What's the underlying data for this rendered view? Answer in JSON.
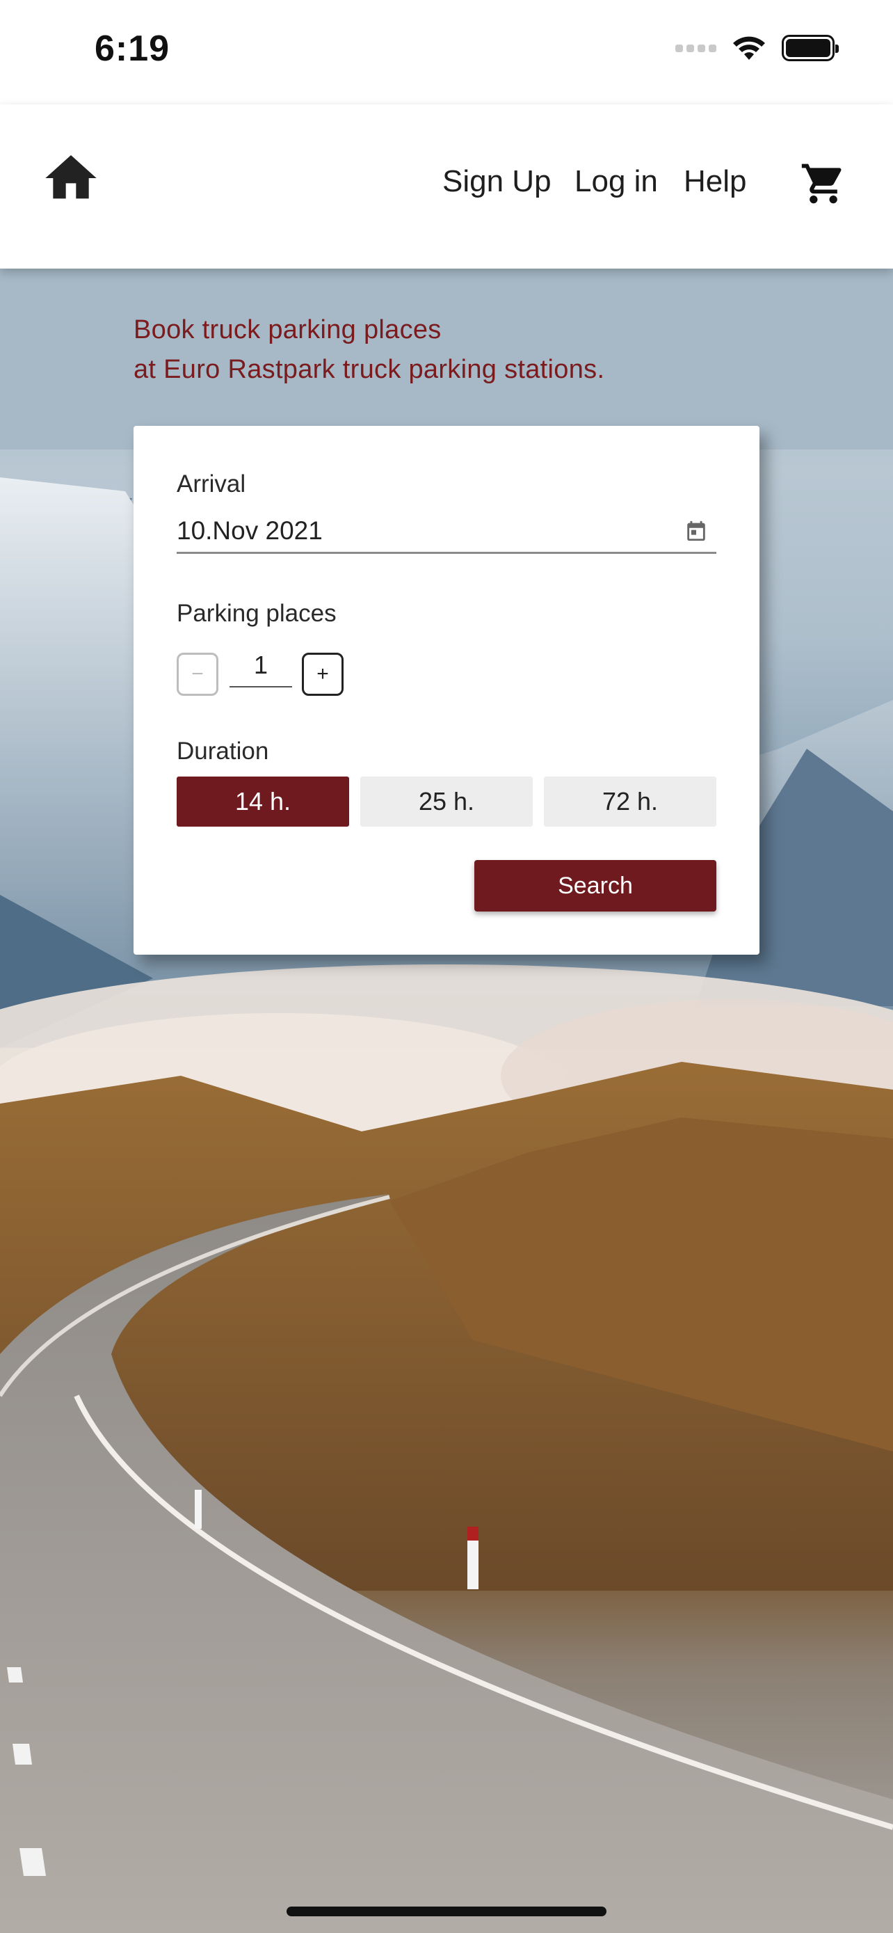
{
  "status_bar": {
    "time": "6:19",
    "icons": [
      "cellular-signal-icon",
      "wifi-icon",
      "battery-icon"
    ]
  },
  "navbar": {
    "home_icon": "home-icon",
    "links": [
      "Sign Up",
      "Log in",
      "Help"
    ],
    "cart_icon": "shopping-cart-icon"
  },
  "hero": {
    "headline_line1": "Book truck parking places",
    "headline_line2": "at Euro Rastpark truck parking stations."
  },
  "booking_form": {
    "arrival_label": "Arrival",
    "arrival_value": "10.Nov 2021",
    "parking_label": "Parking places",
    "minus_label": "−",
    "quantity": "1",
    "plus_label": "+",
    "duration_label": "Duration",
    "durations": [
      "14 h.",
      "25 h.",
      "72 h."
    ],
    "selected_duration": "14 h.",
    "search_label": "Search"
  },
  "colors": {
    "brand": "#6e1a1e",
    "headline": "#7a1b1e",
    "idle_button": "#ededed"
  }
}
